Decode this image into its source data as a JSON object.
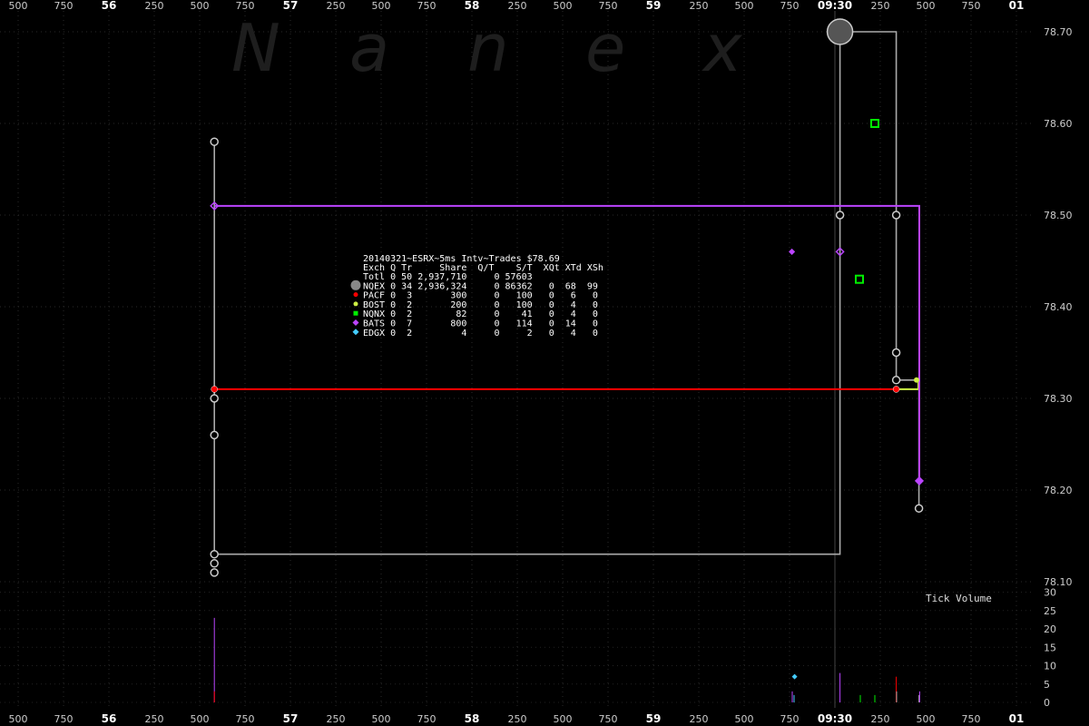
{
  "watermark": [
    "N",
    "a",
    "n",
    "e",
    "x"
  ],
  "colors": {
    "background": "#000000",
    "grid": "#2a2a2a",
    "NQEX": "#aaaaaa",
    "PACF": "#ff0000",
    "BOST": "#ccee44",
    "NQNX": "#00ee00",
    "BATS": "#bb44ff",
    "EDGX": "#44ccff"
  },
  "x_axis_labels": [
    "500",
    "750",
    "56",
    "250",
    "500",
    "750",
    "57",
    "250",
    "500",
    "750",
    "58",
    "250",
    "500",
    "750",
    "59",
    "250",
    "500",
    "750",
    "09:30",
    "250",
    "500",
    "750",
    "01"
  ],
  "x_axis_major": [
    "56",
    "57",
    "58",
    "59",
    "09:30",
    "01"
  ],
  "price_axis": [
    "78.70",
    "78.60",
    "78.50",
    "78.40",
    "78.30",
    "78.20",
    "78.10"
  ],
  "volume_axis": [
    "30",
    "25",
    "20",
    "15",
    "10",
    "5",
    "0"
  ],
  "volume_title": "Tick Volume",
  "table": {
    "title": "20140321~ESRX~5ms Intv~Trades $78.69",
    "header": "Exch Q Tr     Share  Q/T    S/T  XQt XTd XSh",
    "rows": [
      {
        "exch": "Totl",
        "text": "Totl 0 50 2,937,710     0 57603",
        "marker": ""
      },
      {
        "exch": "NQEX",
        "text": "NQEX 0 34 2,936,324     0 86362   0  68  99",
        "marker": "NQEX"
      },
      {
        "exch": "PACF",
        "text": "PACF 0  3       300     0   100   0   6   0",
        "marker": "PACF"
      },
      {
        "exch": "BOST",
        "text": "BOST 0  2       200     0   100   0   4   0",
        "marker": "BOST"
      },
      {
        "exch": "NQNX",
        "text": "NQNX 0  2        82     0    41   0   4   0",
        "marker": "NQNX"
      },
      {
        "exch": "BATS",
        "text": "BATS 0  7       800     0   114   0  14   0",
        "marker": "BATS"
      },
      {
        "exch": "EDGX",
        "text": "EDGX 0  2         4     0     2   0   4   0",
        "marker": "EDGX"
      }
    ]
  },
  "chart_data": {
    "type": "scatter",
    "price_ylim": [
      78.08,
      78.73
    ],
    "volume_ylim": [
      0,
      30
    ],
    "x_ticks_ms": [
      0,
      250,
      500,
      750,
      1000,
      1250,
      1500,
      1750,
      2000,
      2250,
      2500,
      2750,
      3000,
      3250,
      3500,
      3750,
      4000,
      4250,
      4500,
      4750,
      5000,
      5250,
      5500
    ],
    "x_tick_labels": [
      "500",
      "750",
      "56",
      "250",
      "500",
      "750",
      "57",
      "250",
      "500",
      "750",
      "58",
      "250",
      "500",
      "750",
      "59",
      "250",
      "500",
      "750",
      "09:30",
      "250",
      "500",
      "750",
      "01"
    ],
    "series": [
      {
        "name": "NQEX",
        "color": "#aaaaaa",
        "points": [
          [
            1081,
            78.58
          ],
          [
            1081,
            78.3
          ],
          [
            1081,
            78.26
          ],
          [
            1081,
            78.13
          ],
          [
            1081,
            78.12
          ],
          [
            1081,
            78.11
          ],
          [
            4528,
            78.7
          ],
          [
            4528,
            78.5
          ],
          [
            4838,
            78.5
          ],
          [
            4838,
            78.35
          ],
          [
            4838,
            78.32
          ],
          [
            4963,
            78.18
          ]
        ],
        "line": [
          [
            1081,
            78.58
          ],
          [
            1081,
            78.13
          ],
          [
            4528,
            78.13
          ],
          [
            4528,
            78.7
          ],
          [
            4838,
            78.7
          ],
          [
            4838,
            78.32
          ],
          [
            4963,
            78.32
          ],
          [
            4963,
            78.18
          ]
        ]
      },
      {
        "name": "PACF",
        "color": "#ff0000",
        "points": [
          [
            1081,
            78.31
          ],
          [
            4838,
            78.31
          ]
        ],
        "line": [
          [
            1081,
            78.31
          ],
          [
            4838,
            78.31
          ]
        ]
      },
      {
        "name": "BOST",
        "color": "#ccee44",
        "points": [
          [
            4950,
            78.32
          ]
        ],
        "line": [
          [
            4838,
            78.31
          ],
          [
            4960,
            78.31
          ],
          [
            4960,
            78.32
          ]
        ]
      },
      {
        "name": "NQNX",
        "color": "#00ee00",
        "points": [
          [
            4720,
            78.6
          ],
          [
            4635,
            78.43
          ]
        ],
        "line": []
      },
      {
        "name": "BATS",
        "color": "#bb44ff",
        "points": [
          [
            1081,
            78.51
          ],
          [
            4263,
            78.46
          ],
          [
            4528,
            78.46
          ],
          [
            4965,
            78.21
          ]
        ],
        "line": [
          [
            1081,
            78.51
          ],
          [
            4965,
            78.51
          ],
          [
            4965,
            78.21
          ]
        ]
      },
      {
        "name": "EDGX",
        "color": "#44ccff",
        "points": [
          [
            4278,
            78.07
          ]
        ],
        "line": []
      }
    ],
    "volume": [
      {
        "x": 1081,
        "value": 23,
        "color": "#bb44ff"
      },
      {
        "x": 1081,
        "value": 3,
        "color": "#ff0000"
      },
      {
        "x": 4265,
        "value": 3,
        "color": "#bb44ff"
      },
      {
        "x": 4275,
        "value": 2,
        "color": "#44ccff"
      },
      {
        "x": 4528,
        "value": 8,
        "color": "#bb44ff"
      },
      {
        "x": 4640,
        "value": 2,
        "color": "#00ee00"
      },
      {
        "x": 4720,
        "value": 2,
        "color": "#00ee00"
      },
      {
        "x": 4838,
        "value": 7,
        "color": "#ff0000"
      },
      {
        "x": 4840,
        "value": 3,
        "color": "#aaaaaa"
      },
      {
        "x": 4963,
        "value": 2,
        "color": "#aaaaaa"
      },
      {
        "x": 4967,
        "value": 3,
        "color": "#bb44ff"
      }
    ],
    "grid": true
  }
}
